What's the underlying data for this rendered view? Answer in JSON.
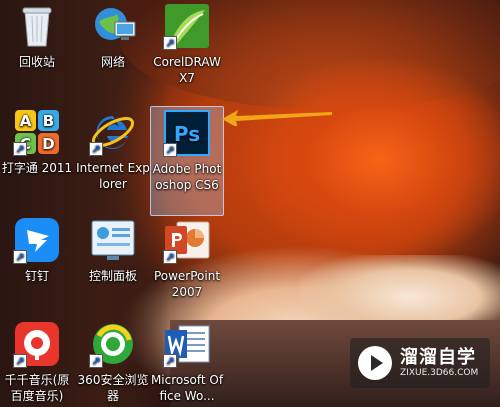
{
  "desktop": {
    "icons": [
      {
        "label": "回收站",
        "icon": "recycle-bin-icon"
      },
      {
        "label": "网络",
        "icon": "network-icon"
      },
      {
        "label": "CorelDRAW X7",
        "icon": "coreldraw-icon"
      },
      {
        "label": "打字通 2011",
        "icon": "typing-app-icon"
      },
      {
        "label": "Internet Explorer",
        "icon": "internet-explorer-icon"
      },
      {
        "label": "Adobe Photoshop CS6",
        "icon": "photoshop-icon",
        "glyph": "Ps"
      },
      {
        "label": "钉钉",
        "icon": "dingtalk-icon"
      },
      {
        "label": "控制面板",
        "icon": "control-panel-icon"
      },
      {
        "label": "PowerPoint 2007",
        "icon": "powerpoint-icon"
      },
      {
        "label": "千千音乐(原百度音乐)",
        "icon": "qianqian-music-icon"
      },
      {
        "label": "360安全浏览器",
        "icon": "360-browser-icon"
      },
      {
        "label": "Microsoft Office Wo...",
        "icon": "word-icon"
      }
    ],
    "selected": "Adobe Photoshop CS6",
    "typing_letters": [
      "A",
      "B",
      "C",
      "D"
    ]
  },
  "watermark": {
    "title": "溜溜自学",
    "subtitle": "ZIXUE.3D66.COM"
  },
  "colors": {
    "arrow": "#f2a516",
    "photoshop": "#001e36",
    "photoshop_accent": "#31a8ff"
  }
}
